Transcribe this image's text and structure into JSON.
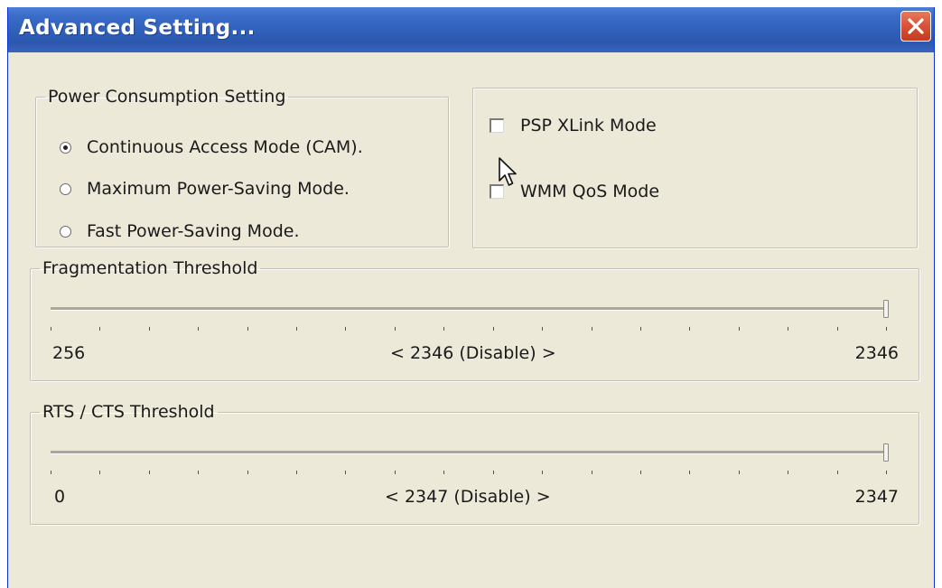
{
  "window": {
    "title": "Advanced Setting...",
    "colors": {
      "titlebar": "#2f5fb8",
      "face": "#ece9d8",
      "close": "#d9553a"
    }
  },
  "power": {
    "legend": "Power Consumption Setting",
    "options": [
      {
        "label": "Continuous Access Mode (CAM).",
        "checked": true
      },
      {
        "label": "Maximum Power-Saving Mode.",
        "checked": false
      },
      {
        "label": "Fast Power-Saving Mode.",
        "checked": false
      }
    ]
  },
  "modes": {
    "psp": {
      "label": "PSP XLink Mode",
      "checked": false
    },
    "wmm": {
      "label": "WMM QoS Mode",
      "checked": false
    }
  },
  "fragmentation": {
    "legend": "Fragmentation Threshold",
    "min_label": "256",
    "max_label": "2346",
    "current_label": "< 2346 (Disable) >",
    "min": 256,
    "max": 2346,
    "value": 2346
  },
  "rts": {
    "legend": "RTS / CTS Threshold",
    "min_label": "0",
    "max_label": "2347",
    "current_label": "< 2347 (Disable) >",
    "min": 0,
    "max": 2347,
    "value": 2347
  },
  "icons": [
    "close-icon",
    "mouse-pointer-icon"
  ]
}
